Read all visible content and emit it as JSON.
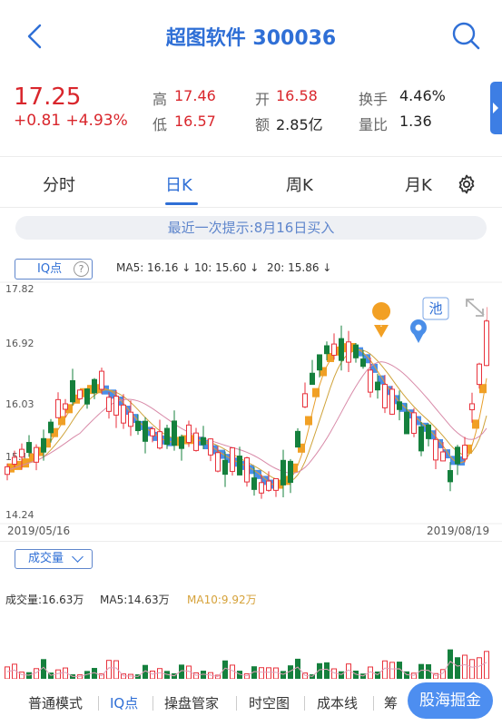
{
  "header": {
    "title": "超图软件 300036"
  },
  "quote": {
    "price": "17.25",
    "change": "+0.81 +4.93%",
    "high_label": "高",
    "high": "17.46",
    "low_label": "低",
    "low": "16.57",
    "open_label": "开",
    "open": "16.58",
    "amount_label": "额",
    "amount": "2.85亿",
    "turnover_label": "换手",
    "turnover": "4.46%",
    "volratio_label": "量比",
    "volratio": "1.36"
  },
  "tabs": [
    {
      "label": "分时"
    },
    {
      "label": "日K"
    },
    {
      "label": "周K"
    },
    {
      "label": "月K"
    }
  ],
  "active_tab": "日K",
  "hint": "最近一次提示:8月16日买入",
  "iq": {
    "label": "IQ点",
    "help": "?"
  },
  "ma": {
    "ma5": "MA5: 16.16 ↓",
    "ma10": "10: 15.60 ↓",
    "ma20": "20: 15.86 ↓"
  },
  "pool_label": "池",
  "chart_data": {
    "type": "candlestick",
    "y_ticks": [
      "17.82",
      "16.92",
      "16.03",
      "15.13",
      "14.24"
    ],
    "ylim": [
      14.24,
      17.82
    ],
    "x_start": "2019/05/16",
    "x_end": "2019/08/19",
    "last_close": 17.25,
    "last_high": 17.46,
    "last_low": 16.57,
    "last_open": 16.58,
    "colors": {
      "up": "#e8323c",
      "down": "#15803d",
      "iq_buy": "#f2a024",
      "iq_sell": "#4a8ee8",
      "ma5": "#e79f2c",
      "ma10": "#cfa33a",
      "ma20": "#d88aa8"
    }
  },
  "volume": {
    "button_label": "成交量",
    "vol": "成交量:16.63万",
    "ma5": "MA5:14.63万",
    "ma10": "MA10:9.92万"
  },
  "bottom_nav": [
    {
      "label": "普通模式"
    },
    {
      "label": "IQ点"
    },
    {
      "label": "操盘管家"
    },
    {
      "label": "时空图"
    },
    {
      "label": "成本线"
    },
    {
      "label": "筹"
    }
  ],
  "gold_button": "股海掘金"
}
